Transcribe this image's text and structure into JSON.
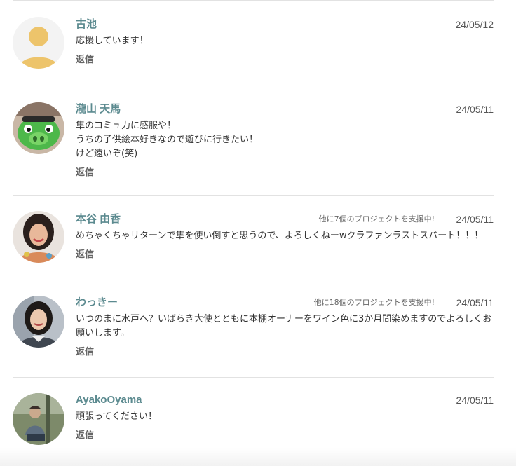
{
  "reply_label": "返信",
  "comments": [
    {
      "name": "古池",
      "date": "24/05/12",
      "support": "",
      "body": "応援しています！",
      "avatar": "default-avatar-icon"
    },
    {
      "name": "瀧山 天馬",
      "date": "24/05/11",
      "support": "",
      "body": "隼のコミュ力に感服や！\nうちの子供絵本好きなので遊びに行きたい！\nけど遠いぞ(笑)",
      "avatar": "green-character-photo"
    },
    {
      "name": "本谷 由香",
      "date": "24/05/11",
      "support": "他に7個のプロジェクトを支援中!",
      "body": "めちゃくちゃリターンで隼を使い倒すと思うので、よろしくねーwクラファンラストスパート！！！",
      "avatar": "woman-smiling-photo"
    },
    {
      "name": "わっきー",
      "date": "24/05/11",
      "support": "他に18個のプロジェクトを支援中!",
      "body": "いつのまに水戸へ？いばらき大使とともに本棚オーナーをワイン色に3か月間染めますのでよろしくお願いします。",
      "avatar": "woman-portrait-photo"
    },
    {
      "name": "AyakoOyama",
      "date": "24/05/11",
      "support": "",
      "body": "頑張ってください！",
      "avatar": "person-outdoor-photo"
    }
  ]
}
